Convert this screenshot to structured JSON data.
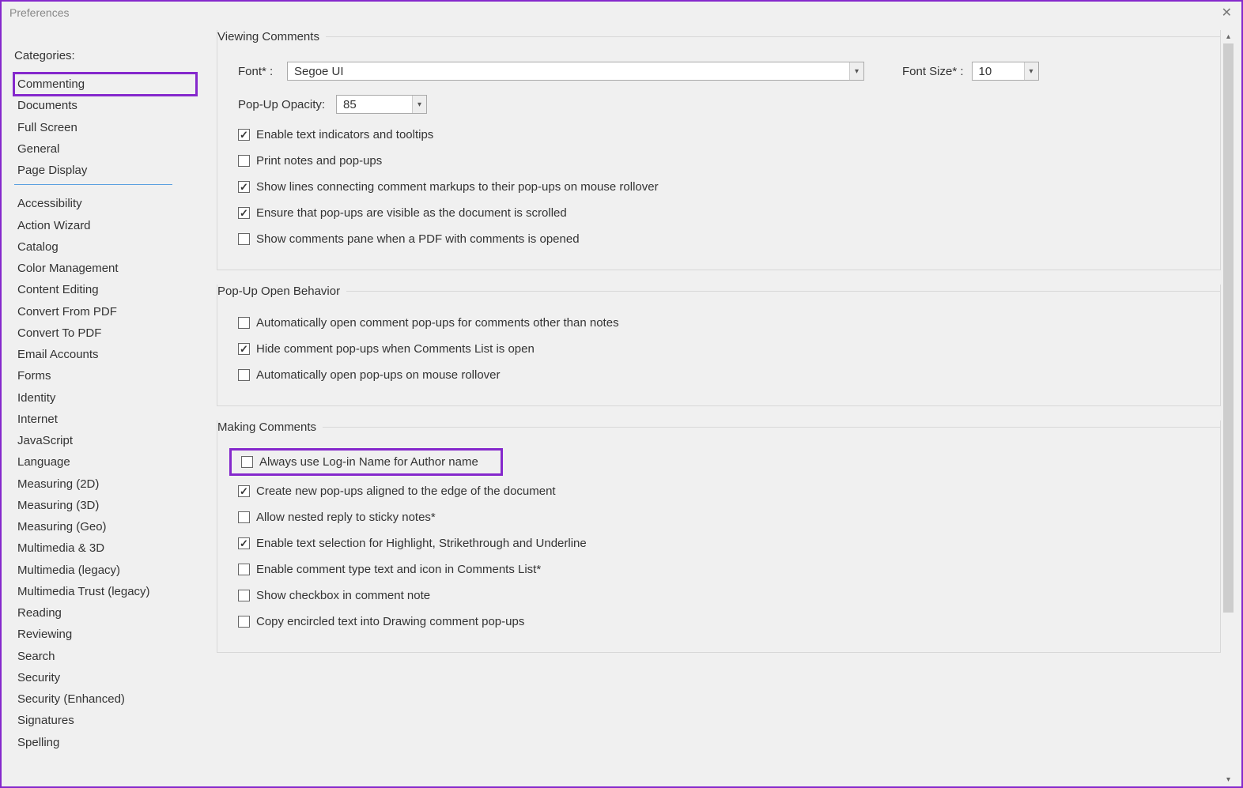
{
  "window": {
    "title": "Preferences",
    "close_icon": "✕"
  },
  "sidebar": {
    "label": "Categories:",
    "group1": [
      "Commenting",
      "Documents",
      "Full Screen",
      "General",
      "Page Display"
    ],
    "group2": [
      "Accessibility",
      "Action Wizard",
      "Catalog",
      "Color Management",
      "Content Editing",
      "Convert From PDF",
      "Convert To PDF",
      "Email Accounts",
      "Forms",
      "Identity",
      "Internet",
      "JavaScript",
      "Language",
      "Measuring (2D)",
      "Measuring (3D)",
      "Measuring (Geo)",
      "Multimedia & 3D",
      "Multimedia (legacy)",
      "Multimedia Trust (legacy)",
      "Reading",
      "Reviewing",
      "Search",
      "Security",
      "Security (Enhanced)",
      "Signatures",
      "Spelling"
    ],
    "selected": "Commenting"
  },
  "groups": {
    "viewing": {
      "title": "Viewing Comments",
      "font_label": "Font* :",
      "font_value": "Segoe UI",
      "fontsize_label": "Font Size* :",
      "fontsize_value": "10",
      "opacity_label": "Pop-Up Opacity:",
      "opacity_value": "85",
      "checks": [
        {
          "label": "Enable text indicators and tooltips",
          "checked": true
        },
        {
          "label": "Print notes and pop-ups",
          "checked": false
        },
        {
          "label": "Show lines connecting comment markups to their pop-ups on mouse rollover",
          "checked": true
        },
        {
          "label": "Ensure that pop-ups are visible as the document is scrolled",
          "checked": true
        },
        {
          "label": "Show comments pane when a PDF with comments is opened",
          "checked": false
        }
      ]
    },
    "popup": {
      "title": "Pop-Up Open Behavior",
      "checks": [
        {
          "label": "Automatically open comment pop-ups for comments other than notes",
          "checked": false
        },
        {
          "label": "Hide comment pop-ups when Comments List is open",
          "checked": true
        },
        {
          "label": "Automatically open pop-ups on mouse rollover",
          "checked": false
        }
      ]
    },
    "making": {
      "title": "Making Comments",
      "checks": [
        {
          "label": "Always use Log-in Name for Author name",
          "checked": false,
          "highlight": true
        },
        {
          "label": "Create new pop-ups aligned to the edge of the document",
          "checked": true
        },
        {
          "label": "Allow nested reply to sticky notes*",
          "checked": false
        },
        {
          "label": "Enable text selection for Highlight, Strikethrough and Underline",
          "checked": true
        },
        {
          "label": "Enable comment type text and icon in Comments List*",
          "checked": false
        },
        {
          "label": "Show checkbox in comment note",
          "checked": false
        },
        {
          "label": "Copy encircled text into Drawing comment pop-ups",
          "checked": false
        }
      ]
    }
  }
}
